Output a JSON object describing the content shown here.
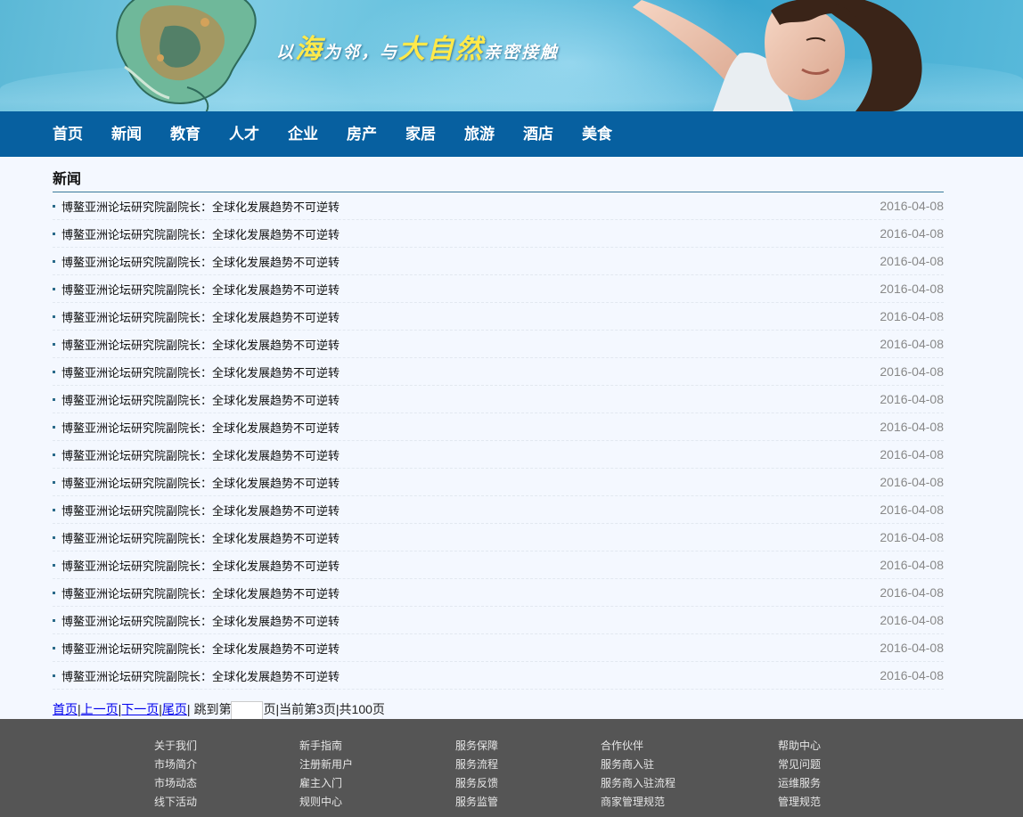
{
  "banner": {
    "slogan_1": "以",
    "slogan_2": "海",
    "slogan_3": "为邻，与",
    "slogan_4": "大自然",
    "slogan_5": "亲密接触"
  },
  "nav": {
    "items": [
      "首页",
      "新闻",
      "教育",
      "人才",
      "企业",
      "房产",
      "家居",
      "旅游",
      "酒店",
      "美食"
    ]
  },
  "section": {
    "title": "新闻"
  },
  "news": [
    {
      "title": "博鳌亚洲论坛研究院副院长：全球化发展趋势不可逆转",
      "date": "2016-04-08"
    },
    {
      "title": "博鳌亚洲论坛研究院副院长：全球化发展趋势不可逆转",
      "date": "2016-04-08"
    },
    {
      "title": "博鳌亚洲论坛研究院副院长：全球化发展趋势不可逆转",
      "date": "2016-04-08"
    },
    {
      "title": "博鳌亚洲论坛研究院副院长：全球化发展趋势不可逆转",
      "date": "2016-04-08"
    },
    {
      "title": "博鳌亚洲论坛研究院副院长：全球化发展趋势不可逆转",
      "date": "2016-04-08"
    },
    {
      "title": "博鳌亚洲论坛研究院副院长：全球化发展趋势不可逆转",
      "date": "2016-04-08"
    },
    {
      "title": "博鳌亚洲论坛研究院副院长：全球化发展趋势不可逆转",
      "date": "2016-04-08"
    },
    {
      "title": "博鳌亚洲论坛研究院副院长：全球化发展趋势不可逆转",
      "date": "2016-04-08"
    },
    {
      "title": "博鳌亚洲论坛研究院副院长：全球化发展趋势不可逆转",
      "date": "2016-04-08"
    },
    {
      "title": "博鳌亚洲论坛研究院副院长：全球化发展趋势不可逆转",
      "date": "2016-04-08"
    },
    {
      "title": "博鳌亚洲论坛研究院副院长：全球化发展趋势不可逆转",
      "date": "2016-04-08"
    },
    {
      "title": "博鳌亚洲论坛研究院副院长：全球化发展趋势不可逆转",
      "date": "2016-04-08"
    },
    {
      "title": "博鳌亚洲论坛研究院副院长：全球化发展趋势不可逆转",
      "date": "2016-04-08"
    },
    {
      "title": "博鳌亚洲论坛研究院副院长：全球化发展趋势不可逆转",
      "date": "2016-04-08"
    },
    {
      "title": "博鳌亚洲论坛研究院副院长：全球化发展趋势不可逆转",
      "date": "2016-04-08"
    },
    {
      "title": "博鳌亚洲论坛研究院副院长：全球化发展趋势不可逆转",
      "date": "2016-04-08"
    },
    {
      "title": "博鳌亚洲论坛研究院副院长：全球化发展趋势不可逆转",
      "date": "2016-04-08"
    },
    {
      "title": "博鳌亚洲论坛研究院副院长：全球化发展趋势不可逆转",
      "date": "2016-04-08"
    }
  ],
  "pager": {
    "first": "首页",
    "sep": "|",
    "prev": "上一页",
    "next": "下一页",
    "last": "尾页",
    "jump_prefix": "跳到第",
    "jump_value": "",
    "jump_suffix": "页",
    "current": "当前第3页",
    "total": "共100页"
  },
  "footer": {
    "columns": [
      [
        "关于我们",
        "市场简介",
        "市场动态",
        "线下活动"
      ],
      [
        "新手指南",
        "注册新用户",
        "雇主入门",
        "规则中心"
      ],
      [
        "服务保障",
        "服务流程",
        "服务反馈",
        "服务监管"
      ],
      [
        "合作伙伴",
        "服务商入驻",
        "服务商入驻流程",
        "商家管理规范"
      ],
      [
        "帮助中心",
        "常见问题",
        "运维服务",
        "管理规范"
      ]
    ]
  },
  "colors": {
    "nav_bg": "#0760a0",
    "footer_bg": "#555555",
    "page_bg": "#f4f8ff",
    "slogan_highlight": "#ffe94a"
  }
}
